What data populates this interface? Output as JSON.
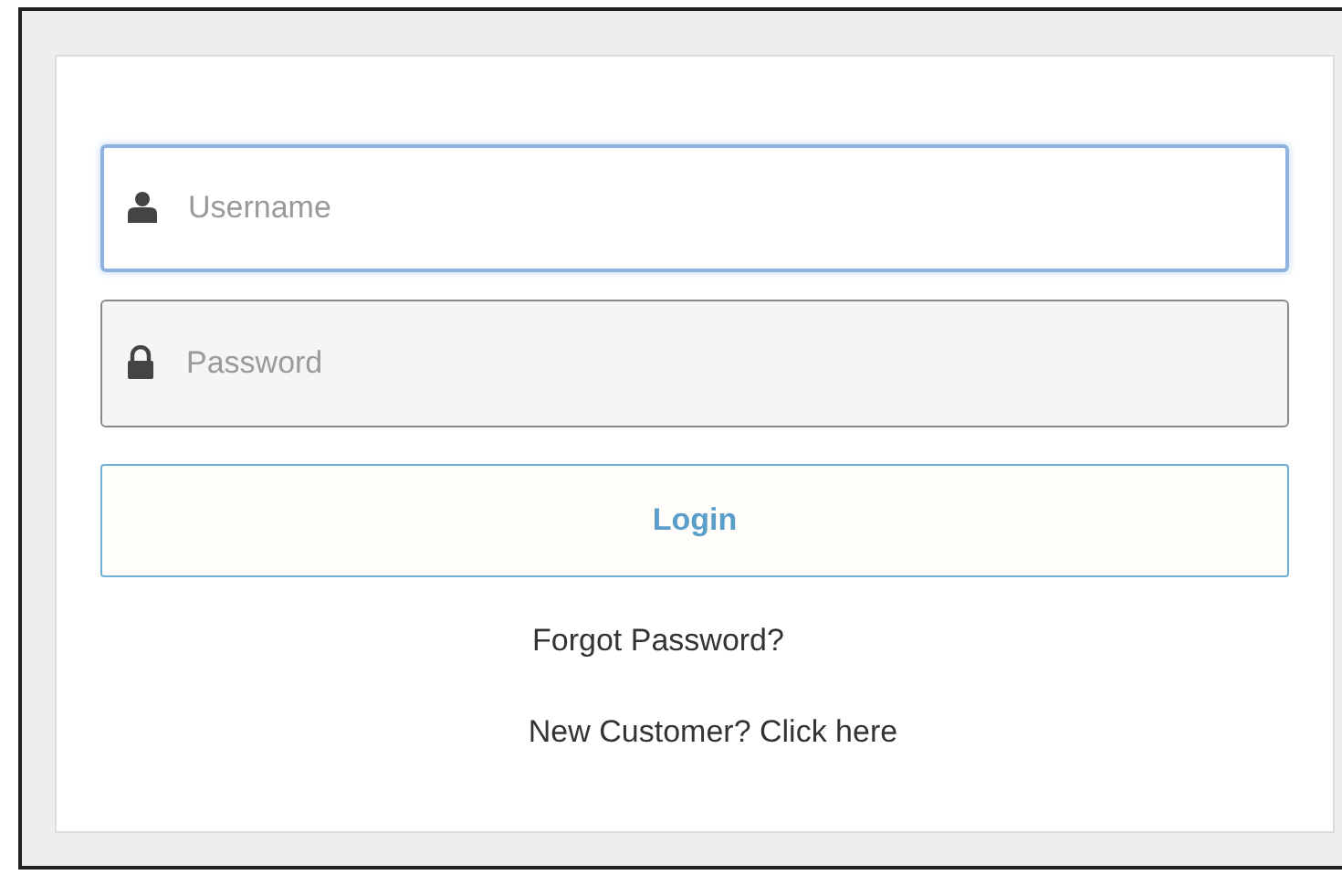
{
  "fields": [
    {
      "kind": "user",
      "placeholder": "Username",
      "focused": true
    },
    {
      "kind": "lock",
      "placeholder": "Password",
      "focused": false
    }
  ],
  "login_button": "Login",
  "forgot_link": "Forgot Password?",
  "signup_link": "New Customer? Click here"
}
